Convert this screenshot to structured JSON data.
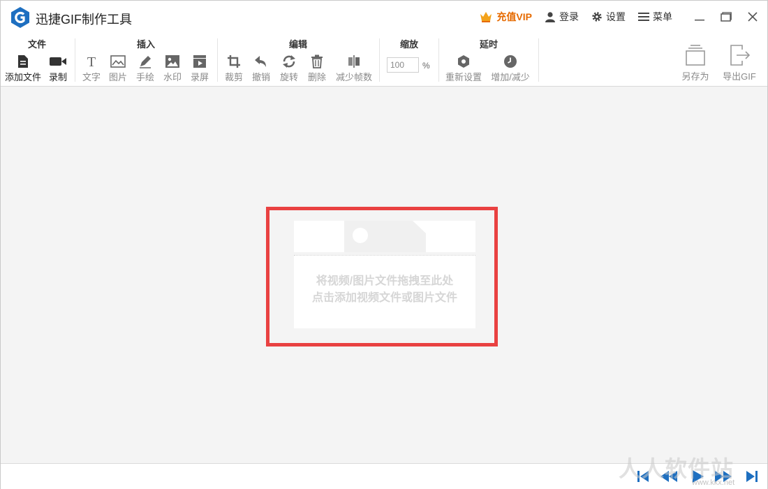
{
  "app": {
    "title": "迅捷GIF制作工具"
  },
  "titlebar": {
    "vip_label": "充值VIP",
    "login_label": "登录",
    "settings_label": "设置",
    "menu_label": "菜单"
  },
  "toolbar": {
    "groups": {
      "file": "文件",
      "insert": "插入",
      "edit": "编辑",
      "zoom": "缩放",
      "delay": "延时"
    },
    "file": {
      "add_file": "添加文件",
      "record": "录制"
    },
    "insert": {
      "text": "文字",
      "image": "图片",
      "draw": "手绘",
      "watermark": "水印",
      "screen_record": "录屏"
    },
    "edit": {
      "crop": "裁剪",
      "undo": "撤销",
      "rotate": "旋转",
      "delete": "删除",
      "reduce_frames": "减少帧数"
    },
    "zoom": {
      "value": "100",
      "unit": "%"
    },
    "delay": {
      "reset": "重新设置",
      "adjust": "增加/减少"
    },
    "save_as": "另存为",
    "export_gif": "导出GIF"
  },
  "dropzone": {
    "line1": "将视频/图片文件拖拽至此处",
    "line2": "点击添加视频文件或图片文件"
  },
  "watermark": {
    "text": "人人软件站",
    "url": "www.kkx.net"
  },
  "colors": {
    "accent_red": "#e94141",
    "vip_orange": "#e66a00",
    "logo_blue": "#1e6fc0"
  }
}
